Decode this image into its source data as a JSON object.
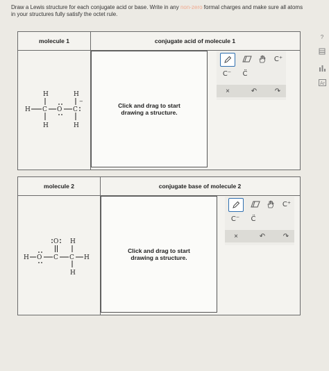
{
  "instructions": {
    "part1": "Draw a Lewis structure for each conjugate acid or base. Write in any",
    "faded": "non-zero",
    "part2": "formal charges and make sure all atoms in your structures fully satisfy the octet rule."
  },
  "panel1": {
    "left_header": "molecule 1",
    "right_header": "conjugate acid of molecule 1",
    "canvas_prompt": "Click and drag to start drawing a structure."
  },
  "panel2": {
    "left_header": "molecule 2",
    "right_header": "conjugate base of molecule 2",
    "canvas_prompt": "Click and drag to start drawing a structure."
  },
  "toolbar": {
    "pencil": "pencil-icon",
    "eraser": "eraser-icon",
    "hand": "hand-icon",
    "positive_charge": "C⁺",
    "negative_charge": "C⁻",
    "lone_pair": "C̈",
    "clear": "×",
    "undo": "↶",
    "redo": "↷"
  },
  "molecule1": {
    "atoms": [
      "H",
      "H",
      "H",
      "C",
      "O",
      "C",
      "H",
      "H"
    ],
    "charge": "−"
  },
  "molecule2": {
    "atoms": [
      "H",
      "O",
      "C",
      "O",
      "C",
      "H",
      "H",
      "H"
    ]
  },
  "side_icons": [
    "help-icon",
    "grid-icon",
    "chart-icon",
    "periodic-table-icon"
  ],
  "side_labels": {
    "help": "?",
    "periodic": "Ar"
  },
  "colors": {
    "selected_tool": "#2f6fb0",
    "faded_text": "#f0a98e"
  }
}
